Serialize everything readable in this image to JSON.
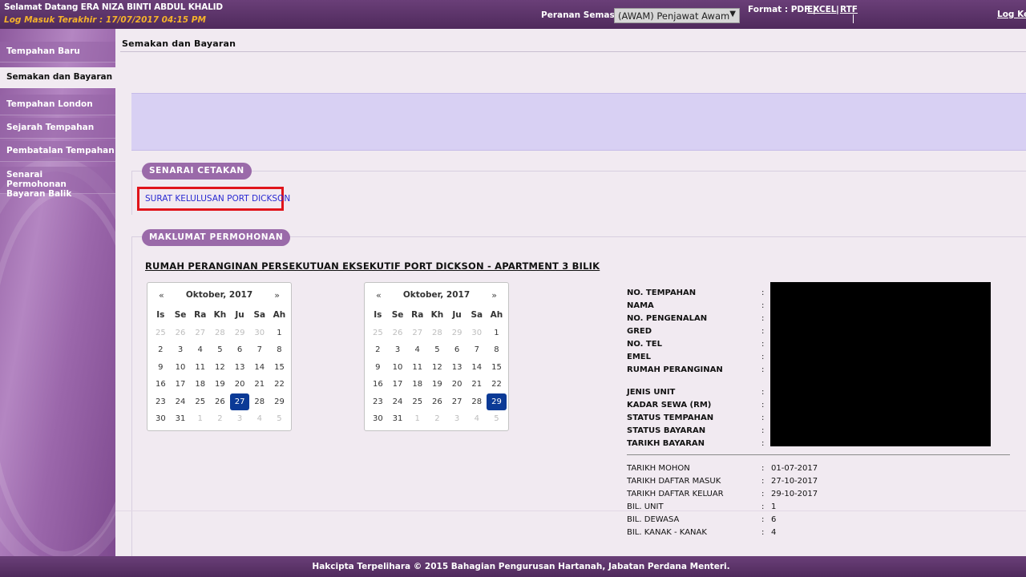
{
  "header": {
    "welcome": "Selamat Datang ERA NIZA BINTI ABDUL KHALID",
    "last_login": "Log Masuk Terakhir : 17/07/2017 04:15 PM",
    "role_label": "Peranan Semasa :",
    "role_value": "(AWAM) Penjawat Awam",
    "format_label": "Format : PDF |",
    "format_excel": "EXCEL",
    "format_sep": "|",
    "format_rtf": "RTF",
    "logout": "Log Keluar"
  },
  "sidebar": {
    "items": [
      {
        "label": "Tempahan Baru"
      },
      {
        "label": "Semakan dan Bayaran"
      },
      {
        "label": "Tempahan London"
      },
      {
        "label": "Sejarah Tempahan"
      },
      {
        "label": "Pembatalan Tempahan"
      },
      {
        "label": "Senarai Permohonan Bayaran Balik"
      }
    ]
  },
  "main": {
    "page_title": "Semakan dan Bayaran",
    "print_section_title": "SENARAI CETAKAN",
    "print_link": "SURAT KELULUSAN PORT DICKSON",
    "info_section_title": "MAKLUMAT PERMOHONAN",
    "property_title": "RUMAH PERANGINAN PERSEKUTUAN EKSEKUTIF PORT DICKSON - APARTMENT 3 BILIK"
  },
  "calendars": [
    {
      "month": "Oktober, 2017",
      "prev": "«",
      "next": "»",
      "weekdays": [
        "Is",
        "Se",
        "Ra",
        "Kh",
        "Ju",
        "Sa",
        "Ah"
      ],
      "weeks": [
        [
          "25",
          "26",
          "27",
          "28",
          "29",
          "30",
          "1"
        ],
        [
          "2",
          "3",
          "4",
          "5",
          "6",
          "7",
          "8"
        ],
        [
          "9",
          "10",
          "11",
          "12",
          "13",
          "14",
          "15"
        ],
        [
          "16",
          "17",
          "18",
          "19",
          "20",
          "21",
          "22"
        ],
        [
          "23",
          "24",
          "25",
          "26",
          "27",
          "28",
          "29"
        ],
        [
          "30",
          "31",
          "1",
          "2",
          "3",
          "4",
          "5"
        ]
      ],
      "selected": "27"
    },
    {
      "month": "Oktober, 2017",
      "prev": "«",
      "next": "»",
      "weekdays": [
        "Is",
        "Se",
        "Ra",
        "Kh",
        "Ju",
        "Sa",
        "Ah"
      ],
      "weeks": [
        [
          "25",
          "26",
          "27",
          "28",
          "29",
          "30",
          "1"
        ],
        [
          "2",
          "3",
          "4",
          "5",
          "6",
          "7",
          "8"
        ],
        [
          "9",
          "10",
          "11",
          "12",
          "13",
          "14",
          "15"
        ],
        [
          "16",
          "17",
          "18",
          "19",
          "20",
          "21",
          "22"
        ],
        [
          "23",
          "24",
          "25",
          "26",
          "27",
          "28",
          "29"
        ],
        [
          "30",
          "31",
          "1",
          "2",
          "3",
          "4",
          "5"
        ]
      ],
      "selected": "29"
    }
  ],
  "details": {
    "bold_rows": [
      {
        "label": "NO. TEMPAHAN",
        "colon": ":"
      },
      {
        "label": "NAMA",
        "colon": ":"
      },
      {
        "label": "NO. PENGENALAN",
        "colon": ":"
      },
      {
        "label": "GRED",
        "colon": ":"
      },
      {
        "label": "NO. TEL",
        "colon": ":"
      },
      {
        "label": "EMEL",
        "colon": ":"
      },
      {
        "label": "RUMAH PERANGINAN",
        "colon": ":"
      },
      {
        "label": "JENIS UNIT",
        "colon": ":"
      },
      {
        "label": "KADAR SEWA (RM)",
        "colon": ":"
      },
      {
        "label": "STATUS TEMPAHAN",
        "colon": ":"
      },
      {
        "label": "STATUS BAYARAN",
        "colon": ":"
      },
      {
        "label": "TARIKH BAYARAN",
        "colon": ":"
      }
    ],
    "plain_rows": [
      {
        "label": "TARIKH MOHON",
        "colon": ":",
        "value": "01-07-2017"
      },
      {
        "label": "TARIKH DAFTAR MASUK",
        "colon": ":",
        "value": "27-10-2017"
      },
      {
        "label": "TARIKH DAFTAR KELUAR",
        "colon": ":",
        "value": "29-10-2017"
      },
      {
        "label": "BIL. UNIT",
        "colon": ":",
        "value": "1"
      },
      {
        "label": "BIL. DEWASA",
        "colon": ":",
        "value": "6"
      },
      {
        "label": "BIL. KANAK - KANAK",
        "colon": ":",
        "value": "4"
      }
    ]
  },
  "footer": {
    "text": "Hakcipta Terpelihara © 2015 Bahagian Pengurusan Hartanah, Jabatan Perdana Menteri."
  }
}
